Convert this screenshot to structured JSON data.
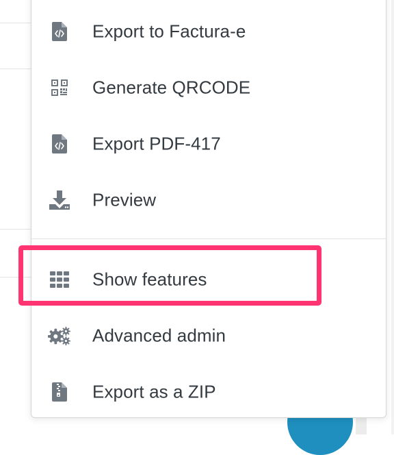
{
  "menu": {
    "items": [
      {
        "label": "Export to Factura-e",
        "icon": "file-code-icon"
      },
      {
        "label": "Generate QRCODE",
        "icon": "qrcode-icon"
      },
      {
        "label": "Export PDF-417",
        "icon": "file-code-icon"
      },
      {
        "label": "Preview",
        "icon": "download-icon"
      },
      {
        "label": "Show features",
        "icon": "grid-icon"
      },
      {
        "label": "Advanced admin",
        "icon": "cogs-icon"
      },
      {
        "label": "Export as a ZIP",
        "icon": "file-zip-icon"
      }
    ]
  },
  "colors": {
    "icon": "#6f7780",
    "text": "#333a40",
    "highlight": "#ff3470",
    "fab": "#1f8fbf"
  }
}
